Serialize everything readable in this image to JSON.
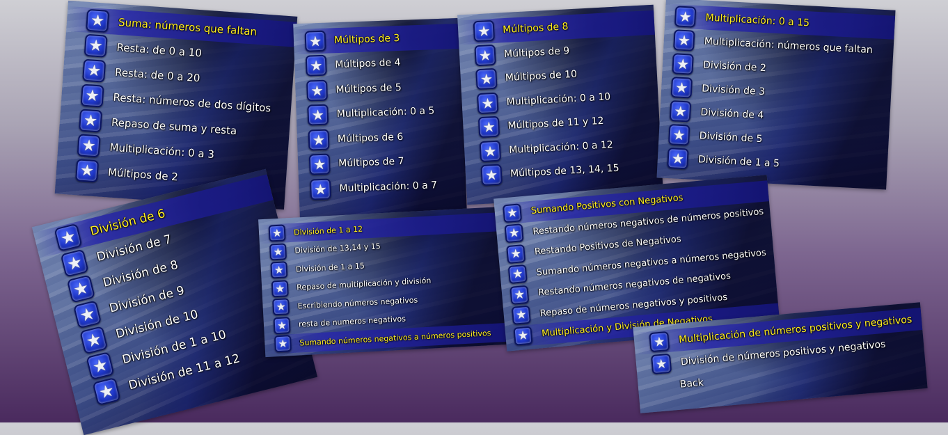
{
  "star_icon": "★",
  "colors": {
    "selected_text": "#ffee22",
    "text": "#ffffff",
    "icon_blue": "#1f37c8"
  },
  "panels": [
    {
      "items": [
        "Suma: números que faltan",
        "Resta: de 0 a 10",
        "Resta: de 0 a 20",
        "Resta: números de dos dígitos",
        "Repaso de suma y resta",
        "Multiplicación: 0 a 3",
        "Múltipos de 2"
      ]
    },
    {
      "items": [
        "Múltipos de 3",
        "Múltipos de 4",
        "Múltipos de 5",
        "Multiplicación: 0 a 5",
        "Múltipos de 6",
        "Múltipos de 7",
        "Multiplicación: 0 a 7"
      ]
    },
    {
      "items": [
        "Múltipos de 8",
        "Múltipos de 9",
        "Múltipos de 10",
        "Multiplicación: 0 a 10",
        "Múltipos de 11 y 12",
        "Multiplicación: 0 a 12",
        "Múltipos de 13, 14, 15"
      ]
    },
    {
      "items": [
        "Multiplicación: 0 a 15",
        "Multiplicación: números que faltan",
        "División de 2",
        "División de 3",
        "División de 4",
        "División de 5",
        "División de 1 a 5"
      ]
    },
    {
      "items": [
        "División de 6",
        "División de 7",
        "División de 8",
        "División de 9",
        "División de 10",
        "División de 1 a 10",
        "División de 11 a 12"
      ]
    },
    {
      "items": [
        "División de 1 a 12",
        "División de 13,14 y 15",
        "División de 1 a 15",
        "Repaso de multiplicación y división",
        "Escribiendo números negativos",
        "resta de numeros negativos",
        "Sumando números negativos a números positivos"
      ]
    },
    {
      "items": [
        "Sumando Positivos con Negativos",
        "Restando números negativos de números positivos",
        "Restando Positivos de Negativos",
        "Sumando números negativos a números negativos",
        "Restando números negativos de negativos",
        "Repaso de números negativos y positivos",
        "Multiplicación y División de Negativos"
      ]
    },
    {
      "items": [
        "Multiplicación de números positivos y negativos",
        "División de números positivos y negativos",
        "Back"
      ]
    }
  ]
}
